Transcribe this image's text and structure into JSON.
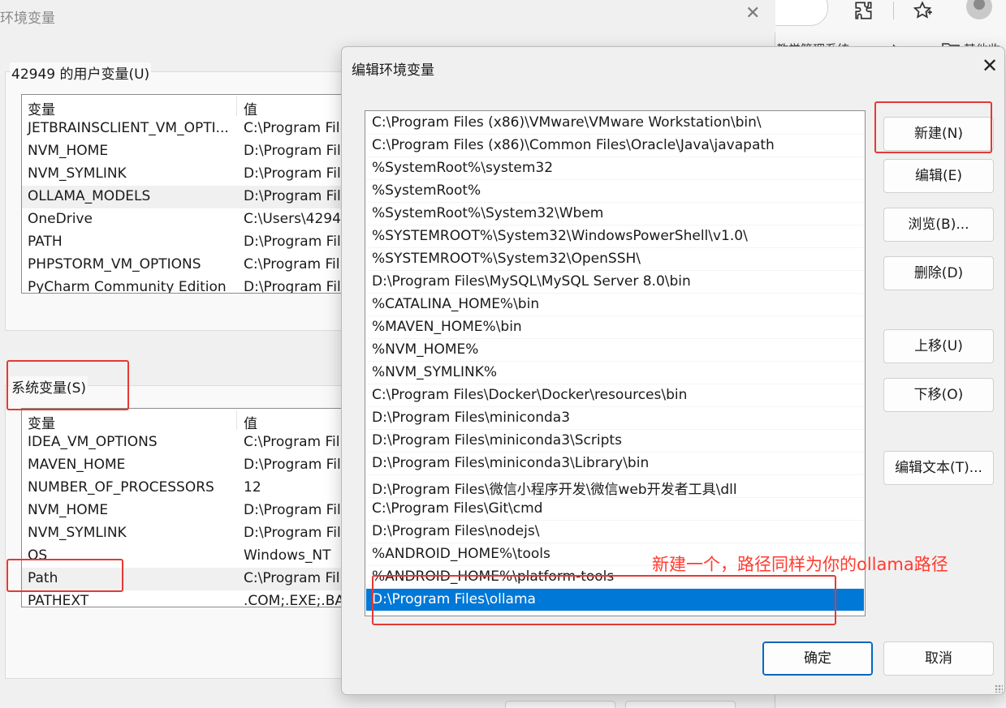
{
  "parent_dialog": {
    "title": "环境变量",
    "user_vars": {
      "label": "42949 的用户变量(U)",
      "headers": [
        "变量",
        "值"
      ],
      "rows": [
        [
          "JETBRAINSCLIENT_VM_OPTI...",
          "C:\\Program Fil"
        ],
        [
          "NVM_HOME",
          "D:\\Program Fil"
        ],
        [
          "NVM_SYMLINK",
          "D:\\Program Fil"
        ],
        [
          "OLLAMA_MODELS",
          "D:\\Program Fil"
        ],
        [
          "OneDrive",
          "C:\\Users\\4294"
        ],
        [
          "PATH",
          "D:\\Program Fil"
        ],
        [
          "PHPSTORM_VM_OPTIONS",
          "C:\\Program Fil"
        ],
        [
          "PyCharm Community Edition",
          "D:\\Program Fil"
        ]
      ]
    },
    "system_vars": {
      "label": "系统变量(S)",
      "headers": [
        "变量",
        "值"
      ],
      "rows": [
        [
          "IDEA_VM_OPTIONS",
          "C:\\Program Fil"
        ],
        [
          "MAVEN_HOME",
          "D:\\Program Fil"
        ],
        [
          "NUMBER_OF_PROCESSORS",
          "12"
        ],
        [
          "NVM_HOME",
          "D:\\Program Fil"
        ],
        [
          "NVM_SYMLINK",
          "D:\\Program Fil"
        ],
        [
          "OS",
          "Windows_NT"
        ],
        [
          "Path",
          "C:\\Program Fil"
        ],
        [
          "PATHEXT",
          ".COM;.EXE;.BA"
        ]
      ]
    }
  },
  "browser": {
    "bookmark_left": "教学管理系统",
    "bookmark_chevron": "›",
    "bookmark_right": "其他收"
  },
  "edit_dialog": {
    "title": "编辑环境变量",
    "close_glyph": "✕",
    "paths": [
      "C:\\Program Files (x86)\\VMware\\VMware Workstation\\bin\\",
      "C:\\Program Files (x86)\\Common Files\\Oracle\\Java\\javapath",
      "%SystemRoot%\\system32",
      "%SystemRoot%",
      "%SystemRoot%\\System32\\Wbem",
      "%SYSTEMROOT%\\System32\\WindowsPowerShell\\v1.0\\",
      "%SYSTEMROOT%\\System32\\OpenSSH\\",
      "D:\\Program Files\\MySQL\\MySQL Server 8.0\\bin",
      "%CATALINA_HOME%\\bin",
      "%MAVEN_HOME%\\bin",
      "%NVM_HOME%",
      "%NVM_SYMLINK%",
      "C:\\Program Files\\Docker\\Docker\\resources\\bin",
      "D:\\Program Files\\miniconda3",
      "D:\\Program Files\\miniconda3\\Scripts",
      "D:\\Program Files\\miniconda3\\Library\\bin",
      "D:\\Program Files\\微信小程序开发\\微信web开发者工具\\dll",
      "C:\\Program Files\\Git\\cmd",
      "D:\\Program Files\\nodejs\\",
      "%ANDROID_HOME%\\tools",
      "%ANDROID_HOME%\\platform-tools",
      "D:\\Program Files\\ollama"
    ],
    "selected_index": 21,
    "buttons": {
      "new": "新建(N)",
      "edit": "编辑(E)",
      "browse": "浏览(B)...",
      "delete": "删除(D)",
      "move_up": "上移(U)",
      "move_down": "下移(O)",
      "edit_text": "编辑文本(T)...",
      "ok": "确定",
      "cancel": "取消"
    }
  },
  "annotation": {
    "text": "新建一个，路径同样为你的ollama路径",
    "color": "#ff3b30"
  },
  "colors": {
    "selection": "#0078d7",
    "highlight_box": "#e53935"
  }
}
